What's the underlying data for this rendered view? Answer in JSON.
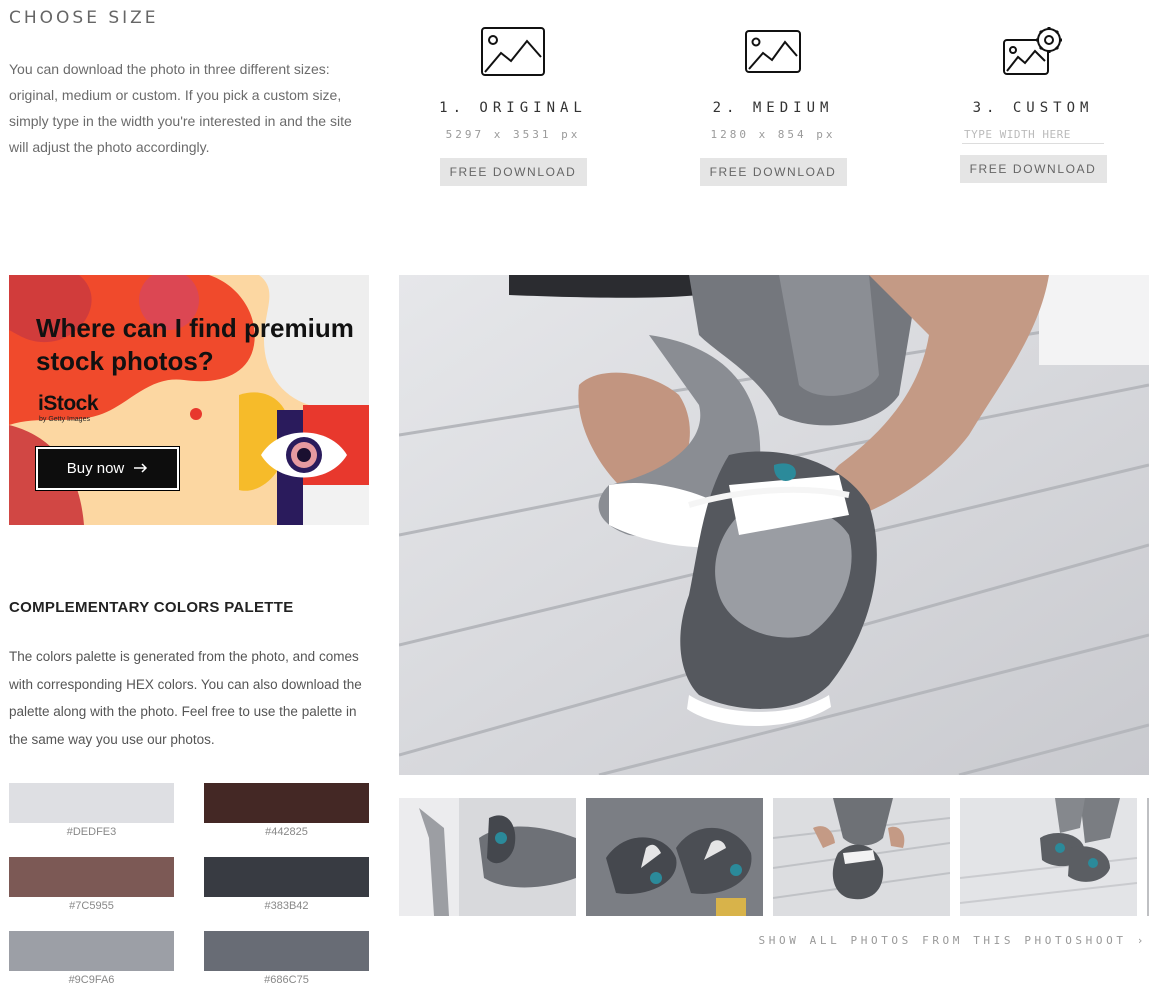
{
  "choose_size": {
    "title": "CHOOSE SIZE",
    "description": "You can download the photo in three different sizes: original, medium or custom. If you pick a custom size, simply type in the width you're interested in and the site will adjust the photo accordingly.",
    "options": [
      {
        "name": "1. ORIGINAL",
        "dimensions": "5297 x 3531 px",
        "button": "FREE DOWNLOAD",
        "icon": "image-icon"
      },
      {
        "name": "2. MEDIUM",
        "dimensions": "1280 x 854 px",
        "button": "FREE DOWNLOAD",
        "icon": "image-icon"
      },
      {
        "name": "3. CUSTOM",
        "input_placeholder": "TYPE WIDTH HERE",
        "button": "FREE DOWNLOAD",
        "icon": "image-settings-icon"
      }
    ]
  },
  "ad": {
    "headline": "Where can I find premium stock photos?",
    "brand": "iStock",
    "brand_sub": "by Getty Images",
    "button": "Buy now",
    "button_icon": "arrow-right-icon"
  },
  "palette": {
    "title": "COMPLEMENTARY COLORS PALETTE",
    "description": "The colors palette is generated from the photo, and comes with corresponding HEX colors. You can also download the palette along with the photo. Feel free to use the palette in the same way you use our photos.",
    "colors": [
      {
        "hex": "#DEDFE3",
        "color": "#dedfe3"
      },
      {
        "hex": "#442825",
        "color": "#442825"
      },
      {
        "hex": "#7C5955",
        "color": "#7c5955"
      },
      {
        "hex": "#383B42",
        "color": "#383b42"
      },
      {
        "hex": "#9C9FA6",
        "color": "#9c9fa6"
      },
      {
        "hex": "#686C75",
        "color": "#686c75"
      }
    ]
  },
  "photoshoot": {
    "show_all": "SHOW ALL PHOTOS FROM THIS PHOTOSHOOT ›"
  }
}
